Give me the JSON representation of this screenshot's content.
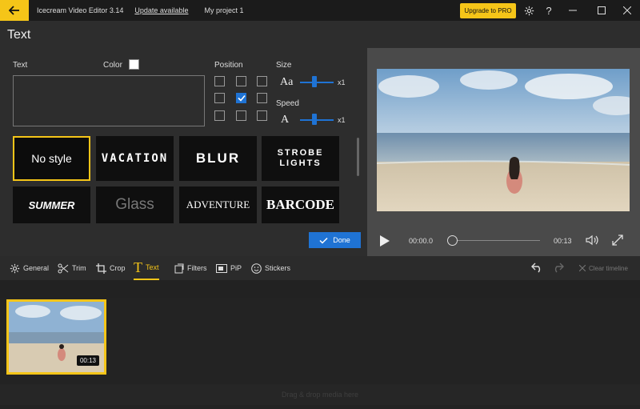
{
  "titlebar": {
    "app_title": "Icecream Video Editor 3.14",
    "update_link": "Update available",
    "project_name": "My project 1",
    "upgrade_label": "Upgrade to PRO"
  },
  "header": {
    "title": "Text"
  },
  "text_panel": {
    "text_label": "Text",
    "color_label": "Color",
    "position_label": "Position",
    "size_label": "Size",
    "speed_label": "Speed",
    "size_value": "x1",
    "speed_value": "x1",
    "size_icon_text": "Aa",
    "speed_icon_text": "A",
    "text_color": "#ffffff",
    "selected_position": "middle-center"
  },
  "styles": [
    {
      "label": "No style",
      "selected": true
    },
    {
      "label": "VACATION"
    },
    {
      "label": "BLUR"
    },
    {
      "label": "STROBE LIGHTS"
    },
    {
      "label": "SUMMER"
    },
    {
      "label": "Glass"
    },
    {
      "label": "ADVENTURE"
    },
    {
      "label": "BARCODE"
    }
  ],
  "done_label": "Done",
  "player": {
    "current_time": "00:00.0",
    "duration": "00:13",
    "progress": 0.0
  },
  "tools": [
    {
      "label": "General",
      "icon": "gear-icon"
    },
    {
      "label": "Trim",
      "icon": "scissors-icon"
    },
    {
      "label": "Crop",
      "icon": "crop-icon"
    },
    {
      "label": "Text",
      "icon": "text-icon",
      "active": true
    },
    {
      "label": "Filters",
      "icon": "filters-icon"
    },
    {
      "label": "PiP",
      "icon": "pip-icon"
    },
    {
      "label": "Stickers",
      "icon": "sticker-icon"
    }
  ],
  "clear_timeline_label": "Clear timeline",
  "timeline": {
    "clip_duration": "00:13",
    "drop_hint": "Drag & drop media here"
  },
  "colors": {
    "accent": "#f5c518",
    "blue": "#1f73d4"
  }
}
